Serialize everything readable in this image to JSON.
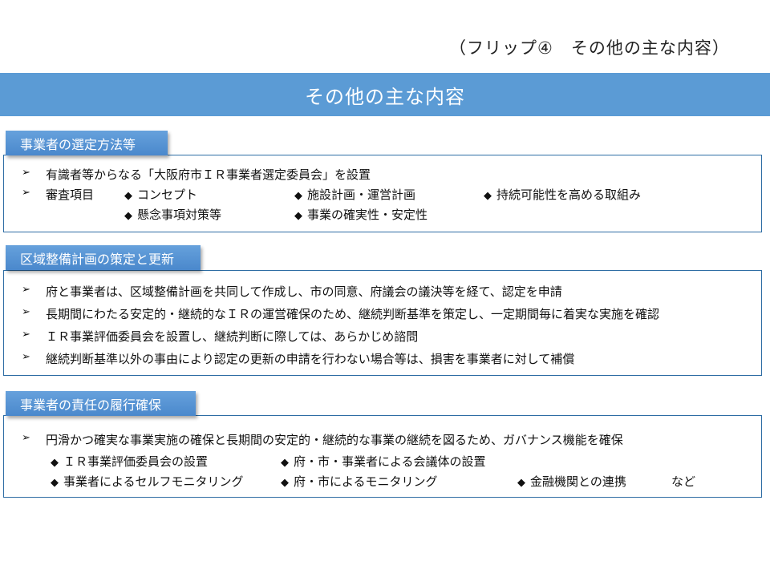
{
  "flip_caption": "（フリップ④　その他の主な内容）",
  "banner": {
    "title": "その他の主な内容"
  },
  "icons": {
    "arrow_bullet": "➢",
    "diamond_bullet": "◆"
  },
  "colors": {
    "banner": "#5b9bd5",
    "tab": "#4a88cc",
    "border": "#2e6da4"
  },
  "sections": [
    {
      "label": "事業者の選定方法等",
      "bullets": [
        {
          "text": "有識者等からなる「大阪府市ＩＲ事業者選定委員会」を設置"
        },
        {
          "text": "審査項目",
          "items": [
            "コンセプト",
            "施設計画・運営計画",
            "持続可能性を高める取組み",
            "懸念事項対策等",
            "事業の確実性・安定性"
          ]
        }
      ]
    },
    {
      "label": "区域整備計画の策定と更新",
      "bullets": [
        {
          "text": "府と事業者は、区域整備計画を共同して作成し、市の同意、府議会の議決等を経て、認定を申請"
        },
        {
          "text": "長期間にわたる安定的・継続的なＩＲの運営確保のため、継続判断基準を策定し、一定期間毎に着実な実施を確認"
        },
        {
          "text": "ＩＲ事業評価委員会を設置し、継続判断に際しては、あらかじめ諮問"
        },
        {
          "text": "継続判断基準以外の事由により認定の更新の申請を行わない場合等は、損害を事業者に対して補償"
        }
      ]
    },
    {
      "label": "事業者の責任の履行確保",
      "bullets": [
        {
          "text": "円滑かつ確実な事業実施の確保と長期間の安定的・継続的な事業の継続を図るため、ガバナンス機能を確保",
          "items": [
            "ＩＲ事業評価委員会の設置",
            "府・市・事業者による会議体の設置",
            "事業者によるセルフモニタリング",
            "府・市によるモニタリング",
            "金融機関との連携"
          ],
          "suffix": "など"
        }
      ]
    }
  ]
}
